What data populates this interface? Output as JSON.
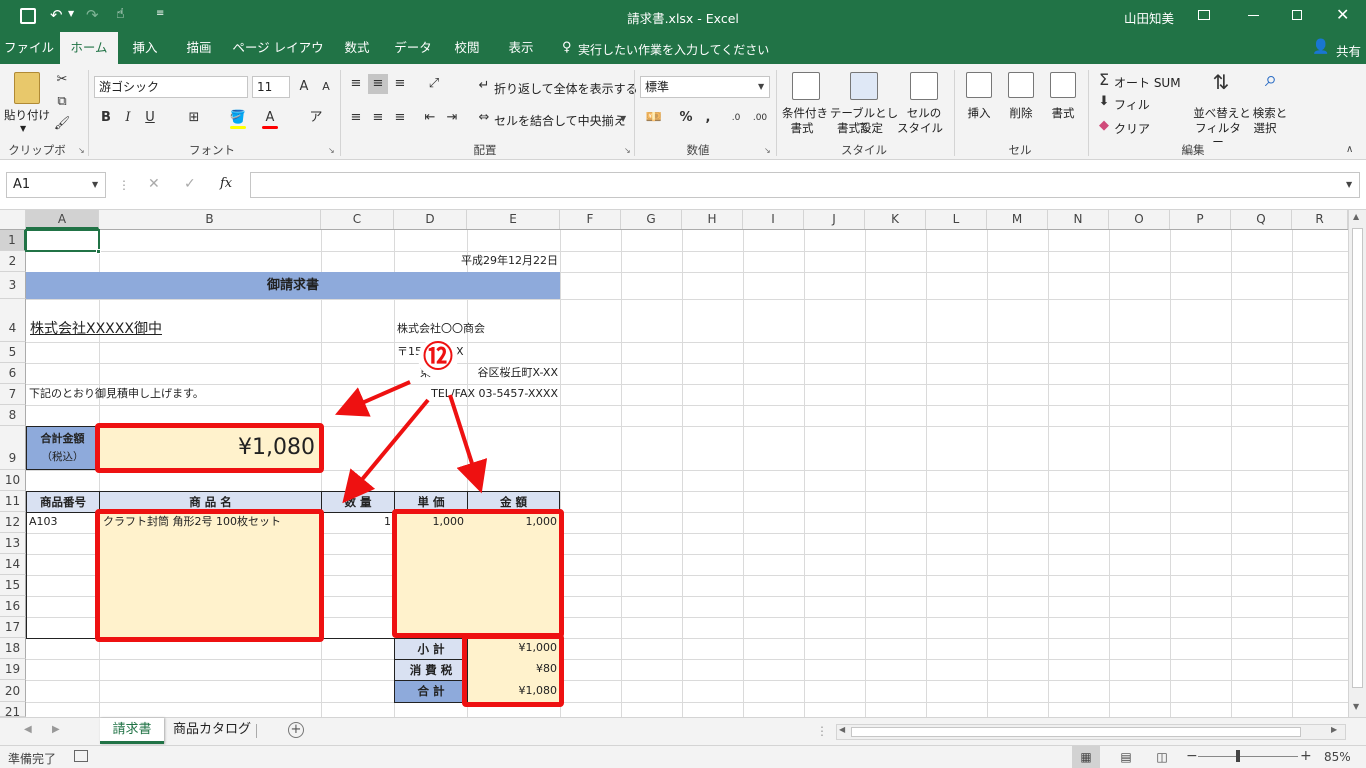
{
  "titlebar": {
    "title": "請求書.xlsx - Excel",
    "user": "山田知美"
  },
  "tabs": [
    "ファイル",
    "ホーム",
    "挿入",
    "描画",
    "ページ レイアウト",
    "数式",
    "データ",
    "校閲",
    "表示"
  ],
  "tell_me": "実行したい作業を入力してください",
  "share": "共有",
  "ribbon": {
    "paste": "貼り付け",
    "clipboard": "クリップボード",
    "font_name": "游ゴシック",
    "font_size": "11",
    "font_group": "フォント",
    "bold": "B",
    "italic": "I",
    "underline": "U",
    "wrap_text": "折り返して全体を表示する",
    "merge_center": "セルを結合して中央揃え",
    "alignment_group": "配置",
    "number_format": "標準",
    "number_group": "数値",
    "percent": "%",
    "comma": ",",
    "cond_format_1": "条件付き",
    "cond_format_2": "書式",
    "table_format_1": "テーブルとして",
    "table_format_2": "書式設定",
    "cell_style_1": "セルの",
    "cell_style_2": "スタイル",
    "style_group": "スタイル",
    "insert": "挿入",
    "delete": "削除",
    "format": "書式",
    "cells_group": "セル",
    "autosum": "オート SUM",
    "fill": "フィル",
    "clear": "クリア",
    "sort_1": "並べ替えと",
    "sort_2": "フィルター",
    "find_1": "検索と",
    "find_2": "選択",
    "editing_group": "編集"
  },
  "formula_bar": {
    "name_box": "A1",
    "fx": "fx",
    "formula": ""
  },
  "columns": [
    "A",
    "B",
    "C",
    "D",
    "E",
    "F",
    "G",
    "H",
    "I",
    "J",
    "K",
    "L",
    "M",
    "N",
    "O",
    "P",
    "Q",
    "R"
  ],
  "rows": [
    "1",
    "2",
    "3",
    "4",
    "5",
    "6",
    "7",
    "8",
    "9",
    "10",
    "11",
    "12",
    "13",
    "14",
    "15",
    "16",
    "17",
    "18",
    "19",
    "20",
    "21"
  ],
  "sheet": {
    "date": "平成29年12月22日",
    "title": "御請求書",
    "client": "株式会社XXXXX御中",
    "company": "株式会社〇〇商会",
    "postal": "〒15",
    "postal_tail": "X",
    "address": "谷区桜丘町X-XX",
    "address_head": "東",
    "tel": "TEL/FAX 03-5457-XXXX",
    "greeting": "下記のとおり御見積申し上げます。",
    "total_label_1": "合計金額",
    "total_label_2": "（税込）",
    "total_value": "¥1,080",
    "h_code": "商品番号",
    "h_name": "商 品 名",
    "h_qty": "数 量",
    "h_price": "単 価",
    "h_amount": "金 額",
    "item_code": "A103",
    "item_name": "クラフト封筒 角形2号 100枚セット",
    "item_qty": "1",
    "item_price": "1,000",
    "item_amount": "1,000",
    "subtotal_label": "小 計",
    "subtotal": "¥1,000",
    "tax_label": "消 費 税",
    "tax": "¥80",
    "grand_label": "合 計",
    "grand": "¥1,080"
  },
  "annotation": {
    "marker": "⑫",
    "color": "#ee1111"
  },
  "sheet_tabs": [
    "請求書",
    "商品カタログ"
  ],
  "status": {
    "ready": "準備完了",
    "zoom": "85%"
  }
}
